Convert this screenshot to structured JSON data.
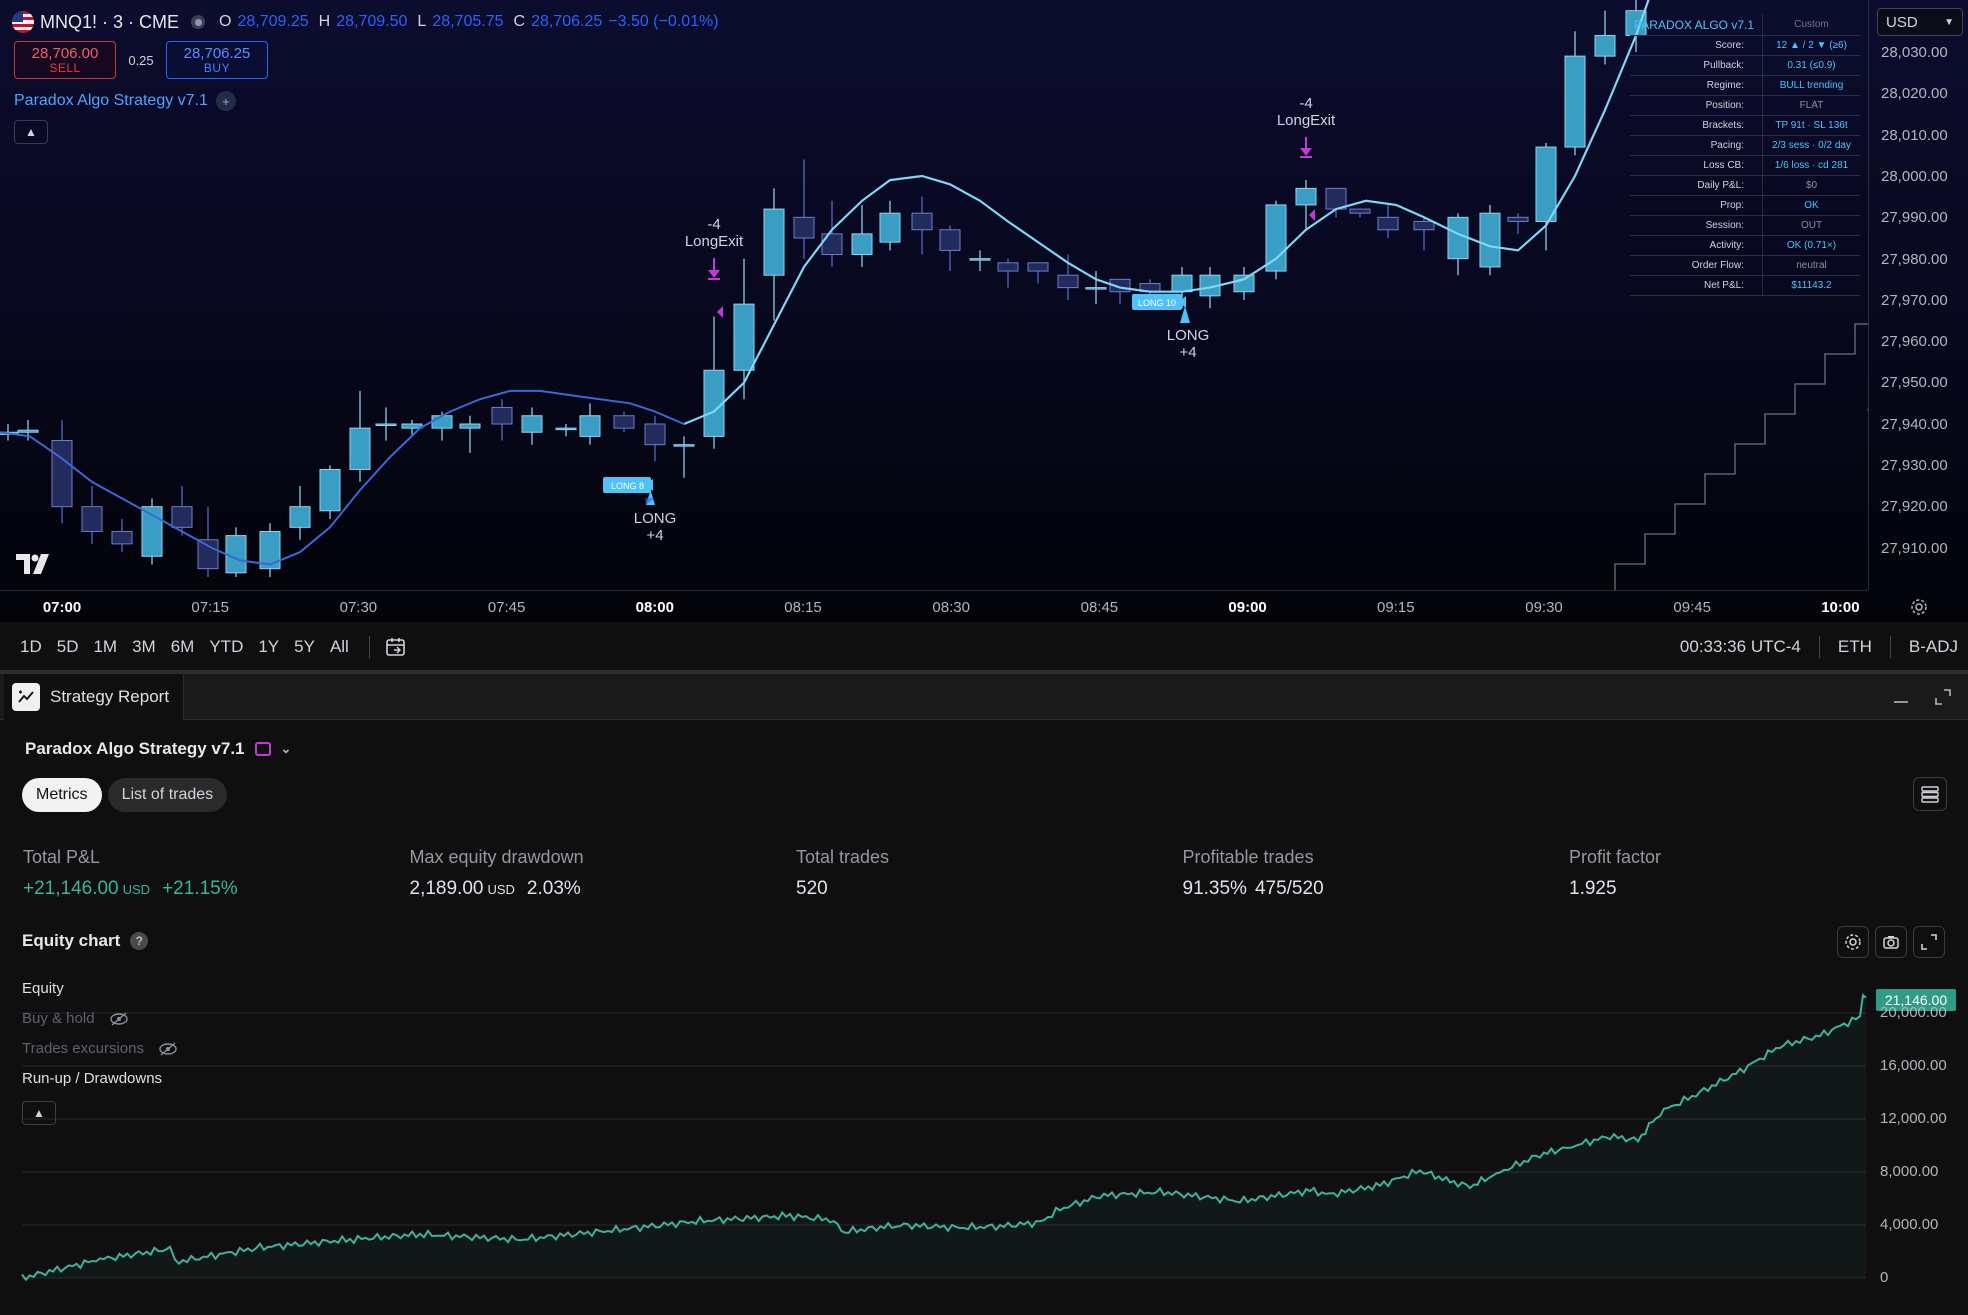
{
  "header": {
    "symbol": "MNQ1! · 3 · CME",
    "open_label": "O",
    "open": "28,709.25",
    "high_label": "H",
    "high": "28,709.50",
    "low_label": "L",
    "low": "28,705.75",
    "close_label": "C",
    "close": "28,706.25",
    "change": "−3.50 (−0.01%)"
  },
  "trade": {
    "sell_price": "28,706.00",
    "sell_label": "SELL",
    "spread": "0.25",
    "buy_price": "28,706.25",
    "buy_label": "BUY"
  },
  "indicator_label": "Paradox Algo Strategy v7.1",
  "stats_table": {
    "title": "PARADOX ALGO v7.1",
    "preset": "Custom",
    "rows": [
      {
        "k": "Score:",
        "v": "12 ▲ / 2 ▼ (≥6)"
      },
      {
        "k": "Pullback:",
        "v": "0.31 (≤0.9)"
      },
      {
        "k": "Regime:",
        "v": "BULL trending"
      },
      {
        "k": "Position:",
        "v": "FLAT"
      },
      {
        "k": "Brackets:",
        "v": "TP 91t · SL 136t"
      },
      {
        "k": "Pacing:",
        "v": "2/3 sess · 0/2 day"
      },
      {
        "k": "Loss CB:",
        "v": "1/6 loss · cd 281"
      },
      {
        "k": "Daily P&L:",
        "v": "$0"
      },
      {
        "k": "Prop:",
        "v": "OK"
      },
      {
        "k": "Session:",
        "v": "OUT"
      },
      {
        "k": "Activity:",
        "v": "OK (0.71×)"
      },
      {
        "k": "Order Flow:",
        "v": "neutral"
      },
      {
        "k": "Net P&L:",
        "v": "$11143.2"
      }
    ]
  },
  "currency": "USD",
  "price_axis": [
    "28,030.00",
    "28,020.00",
    "28,010.00",
    "28,000.00",
    "27,990.00",
    "27,980.00",
    "27,970.00",
    "27,960.00",
    "27,950.00",
    "27,940.00",
    "27,930.00",
    "27,920.00",
    "27,910.00"
  ],
  "time_axis": [
    {
      "t": "07:00",
      "bold": true
    },
    {
      "t": "07:15",
      "bold": false
    },
    {
      "t": "07:30",
      "bold": false
    },
    {
      "t": "07:45",
      "bold": false
    },
    {
      "t": "08:00",
      "bold": true
    },
    {
      "t": "08:15",
      "bold": false
    },
    {
      "t": "08:30",
      "bold": false
    },
    {
      "t": "08:45",
      "bold": false
    },
    {
      "t": "09:00",
      "bold": true
    },
    {
      "t": "09:15",
      "bold": false
    },
    {
      "t": "09:30",
      "bold": false
    },
    {
      "t": "09:45",
      "bold": false
    },
    {
      "t": "10:00",
      "bold": true
    }
  ],
  "signals": {
    "long1_tag": "LONG 8",
    "long1_label": "LONG",
    "long1_qty": "+4",
    "exit1_qty": "-4",
    "exit1_label": "LongExit",
    "long2_tag": "LONG 10",
    "long2_label": "LONG",
    "long2_qty": "+4",
    "exit2_qty": "-4",
    "exit2_label": "LongExit"
  },
  "ranges": [
    "1D",
    "5D",
    "1M",
    "3M",
    "6M",
    "YTD",
    "1Y",
    "5Y",
    "All"
  ],
  "status": {
    "time": "00:33:36 UTC-4",
    "session": "ETH",
    "adj": "B-ADJ"
  },
  "report": {
    "tab_label": "Strategy Report",
    "strategy_name": "Paradox Algo Strategy v7.1",
    "tabs": [
      "Metrics",
      "List of trades"
    ],
    "metrics": [
      {
        "label": "Total P&L",
        "value": "+21,146.00",
        "unit": "USD",
        "extra": "+21.15%"
      },
      {
        "label": "Max equity drawdown",
        "value": "2,189.00",
        "unit": "USD",
        "extra": "2.03%"
      },
      {
        "label": "Total trades",
        "value": "520",
        "unit": "",
        "extra": ""
      },
      {
        "label": "Profitable trades",
        "value": "91.35%",
        "unit": "",
        "extra": "475/520"
      },
      {
        "label": "Profit factor",
        "value": "1.925",
        "unit": "",
        "extra": ""
      }
    ],
    "equity_title": "Equity chart",
    "legend": {
      "equity": "Equity",
      "buyhold": "Buy & hold",
      "excursions": "Trades excursions",
      "runup": "Run-up / Drawdowns"
    },
    "last_equity": "21,146.00",
    "eq_axis": [
      "20,000.00",
      "16,000.00",
      "12,000.00",
      "8,000.00",
      "4,000.00",
      "0"
    ]
  },
  "colors": {
    "bull": "#3ba3c9",
    "bear": "#27336b",
    "ma": "#7fd6f5",
    "equity": "#3fb29a",
    "signal": "#c13ad6"
  }
}
